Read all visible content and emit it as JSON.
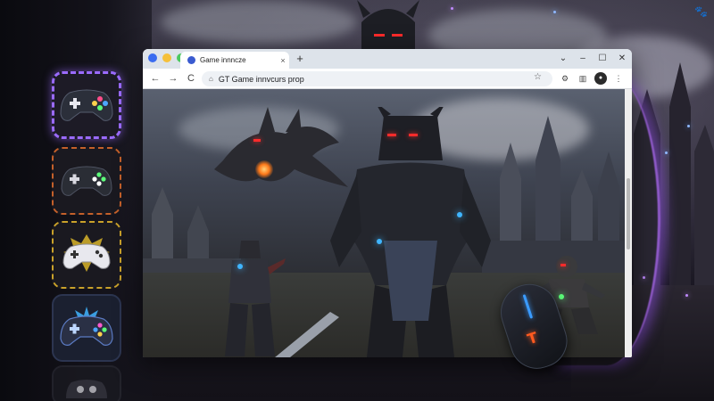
{
  "desktop": {
    "background": "dark fantasy wallpaper",
    "corner_icon": "paw-icon",
    "accent_colors": {
      "purple": "#9b6bff",
      "orange": "#c4602a",
      "gold": "#c9a12a",
      "blue": "#3fb5ff",
      "red_eye": "#ff2b2b"
    }
  },
  "sidebar": {
    "items": [
      {
        "name": "controller-1",
        "icon": "gamepad-icon",
        "border": "#9b6bff",
        "selected": true
      },
      {
        "name": "controller-2",
        "icon": "gamepad-icon",
        "border": "#c4602a",
        "selected": false
      },
      {
        "name": "controller-3",
        "icon": "gamepad-icon",
        "border": "#c9a12a",
        "selected": false
      },
      {
        "name": "controller-4",
        "icon": "gamepad-icon",
        "border": "#2c3550",
        "selected": false
      },
      {
        "name": "controller-5",
        "icon": "gamepad-icon",
        "border": "#2a2a33",
        "selected": false
      }
    ]
  },
  "browser": {
    "tab_title": "Game innncze",
    "tab_close": "×",
    "new_tab": "+",
    "window_controls": {
      "minimize": "⌄",
      "restore": "–",
      "maximize": "☐",
      "close": "✕"
    },
    "nav": {
      "back": "←",
      "forward": "→",
      "reload": "C"
    },
    "address": "GT Game innvcurs prop",
    "address_icon": "⌂",
    "toolbar_icons": [
      "star-icon",
      "extension-icon",
      "sidebar-icon",
      "profile-icon",
      "menu-icon"
    ],
    "toolbar_glyphs": {
      "star": "☆",
      "extension": "⚙",
      "sidebar": "▥",
      "profile": "●",
      "menu": "⋮"
    }
  },
  "mouse": {
    "logo": "T"
  }
}
